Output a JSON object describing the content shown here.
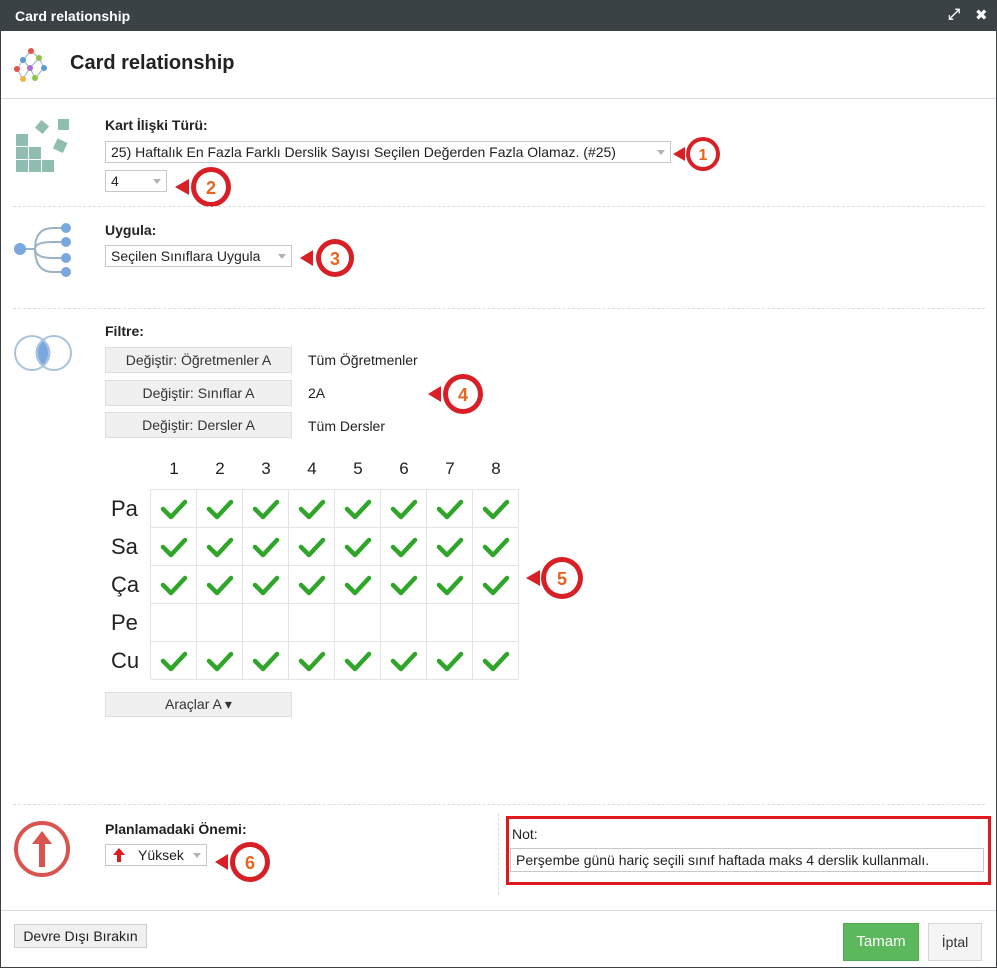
{
  "window": {
    "title": "Card relationship"
  },
  "header": {
    "title": "Card relationship"
  },
  "relation_type": {
    "label": "Kart İlişki Türü:",
    "selected": "25) Haftalık En Fazla Farklı Derslik Sayısı Seçilen Değerden Fazla Olamaz. (#25)",
    "count_selected": "4"
  },
  "apply": {
    "label": "Uygula:",
    "selected": "Seçilen Sınıflara Uygula"
  },
  "filter": {
    "label": "Filtre:",
    "rows": [
      {
        "button": "Değiştir: Öğretmenler A",
        "value": "Tüm Öğretmenler"
      },
      {
        "button": "Değiştir: Sınıflar A",
        "value": "2A"
      },
      {
        "button": "Değiştir: Dersler A",
        "value": "Tüm Dersler"
      }
    ]
  },
  "grid": {
    "columns": [
      "1",
      "2",
      "3",
      "4",
      "5",
      "6",
      "7",
      "8"
    ],
    "rows": [
      "Pa",
      "Sa",
      "Ça",
      "Pe",
      "Cu"
    ],
    "checked": [
      [
        true,
        true,
        true,
        true,
        true,
        true,
        true,
        true
      ],
      [
        true,
        true,
        true,
        true,
        true,
        true,
        true,
        true
      ],
      [
        true,
        true,
        true,
        true,
        true,
        true,
        true,
        true
      ],
      [
        false,
        false,
        false,
        false,
        false,
        false,
        false,
        false
      ],
      [
        true,
        true,
        true,
        true,
        true,
        true,
        true,
        true
      ]
    ]
  },
  "tools": {
    "label": "Araçlar A ▾"
  },
  "importance": {
    "label": "Planlamadaki Önemi:",
    "selected": "Yüksek"
  },
  "note": {
    "label": "Not:",
    "value": "Perşembe günü hariç seçili sınıf haftada maks 4 derslik kullanmalı."
  },
  "footer": {
    "disable_label": "Devre Dışı Bırakın",
    "ok_label": "Tamam",
    "cancel_label": "İptal"
  },
  "callouts": [
    "1",
    "2",
    "3",
    "4",
    "5",
    "6"
  ],
  "colors": {
    "titlebar": "#3b4246",
    "check": "#2fa52a",
    "callout": "#d81f26",
    "callout_text": "#e8651e",
    "ok": "#5cb85c",
    "note_border": "#e0191f"
  },
  "icons": [
    "network-icon",
    "blocks-icon",
    "tree-icon",
    "venn-icon",
    "importance-up-icon",
    "red-arrow-up-icon",
    "expand-icon",
    "close-icon"
  ]
}
